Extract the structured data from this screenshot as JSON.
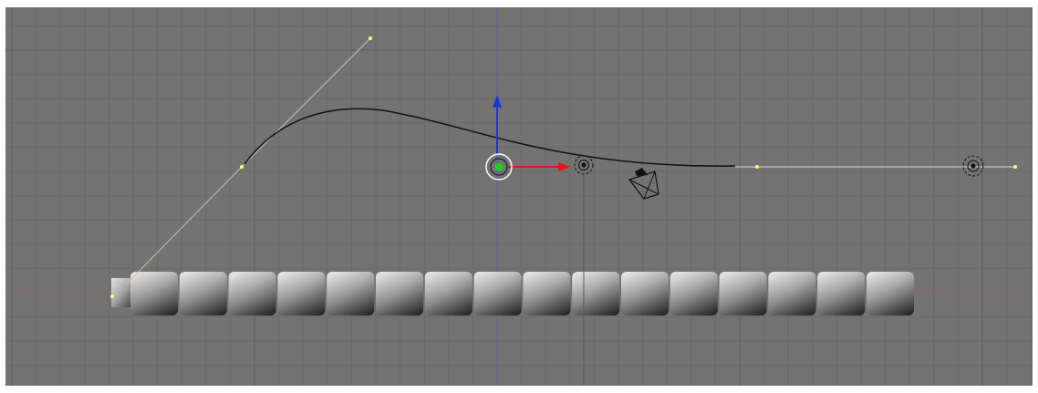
{
  "viewport": {
    "view": "blender-3d-viewport-orthographic",
    "background_color": "#737373",
    "grid_minor_color": "#6a6a6a",
    "grid_major_color": "#5c5c5c",
    "x_axis_color": "#9a5c5c",
    "z_axis_color": "#5e5ea8"
  },
  "scene": {
    "curve": {
      "color": "#111111",
      "handle_color": "#d9b89a",
      "selected_edge_color": "#f0c8c8"
    },
    "cubes": {
      "count": 16,
      "shading": "gradient-grey"
    },
    "camera": {
      "icon": "camera-icon"
    },
    "empties": {
      "count": 2,
      "icon": "empty-target-icon"
    },
    "transform_gizmo": {
      "x_color": "#e01818",
      "z_color": "#2233dd",
      "center_color": "#22cc22"
    }
  }
}
